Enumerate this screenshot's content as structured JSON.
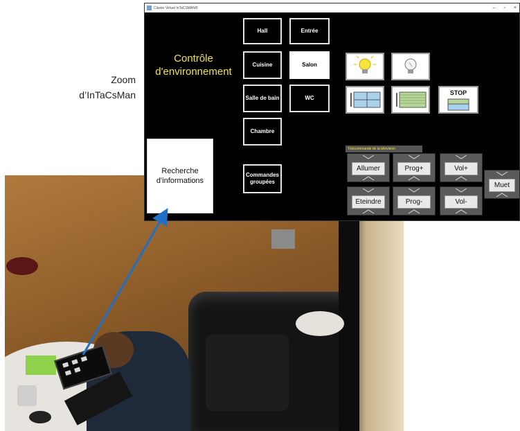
{
  "caption": {
    "line1": "Zoom",
    "line2": "d’InTaCsMan"
  },
  "window": {
    "title": "Clavier Virtuel InTaCSMAN®",
    "controls": {
      "minimize": "–",
      "maximize": "▫",
      "close": "×"
    }
  },
  "main": {
    "heading_line1": "Contrôle",
    "heading_line2": "d'environnement",
    "recherche_line1": "Recherche",
    "recherche_line2": "d'informations"
  },
  "rooms": {
    "hall": "Hall",
    "entree": "Entrée",
    "cuisine": "Cuisine",
    "salon": "Salon",
    "salle_de_bain": "Salle de bain",
    "wc": "WC",
    "chambre": "Chambre",
    "commandes_line1": "Commandes",
    "commandes_line2": "groupées",
    "selected": "Salon"
  },
  "controls": {
    "light_on": "light-on-icon",
    "light_off": "light-off-icon",
    "shutter_up": "shutter-up-icon",
    "shutter_down": "shutter-down-icon",
    "stop_label": "STOP"
  },
  "tv": {
    "label": "Télécommande de la télévision",
    "allumer": "Allumer",
    "prog_plus": "Prog+",
    "vol_plus": "Vol+",
    "eteindre": "Eteindre",
    "prog_minus": "Prog-",
    "vol_minus": "Vol-",
    "muet": "Muet"
  },
  "colors": {
    "accent_yellow": "#f0e442",
    "arrow_blue": "#1f6fc4",
    "window_bg": "#000000"
  }
}
